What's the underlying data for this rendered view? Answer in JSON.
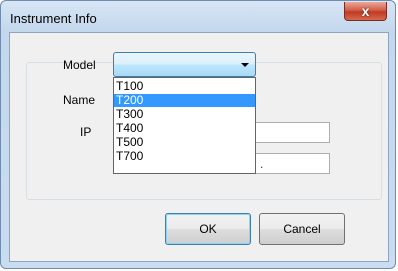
{
  "window": {
    "title": "Instrument Info",
    "close_symbol": "x"
  },
  "form": {
    "model_label": "Model",
    "name_label": "Name",
    "ip_label": "IP",
    "name_value": "",
    "ip_separator": "."
  },
  "model_select": {
    "selected_value": "",
    "options": [
      "T100",
      "T200",
      "T300",
      "T400",
      "T500",
      "T700"
    ],
    "highlighted_option": "T200"
  },
  "buttons": {
    "ok_label": "OK",
    "cancel_label": "Cancel"
  },
  "icons": {
    "close": "close-icon",
    "dropdown": "chevron-down-icon"
  }
}
